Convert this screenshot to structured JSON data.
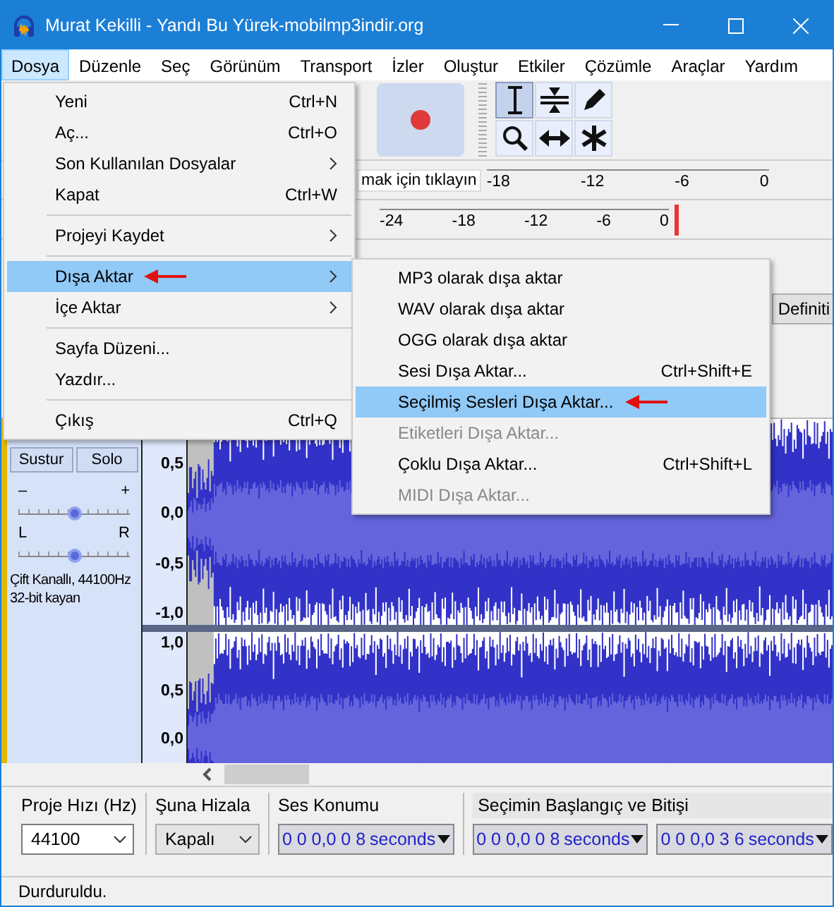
{
  "window": {
    "title": "Murat Kekilli - Yandı Bu Yürek-mobilmp3indir.org"
  },
  "menu_bar": [
    {
      "label": "Dosya",
      "selected": true
    },
    {
      "label": "Düzenle",
      "selected": false
    },
    {
      "label": "Seç",
      "selected": false
    },
    {
      "label": "Görünüm",
      "selected": false
    },
    {
      "label": "Transport",
      "selected": false
    },
    {
      "label": "İzler",
      "selected": false
    },
    {
      "label": "Oluştur",
      "selected": false
    },
    {
      "label": "Etkiler",
      "selected": false
    },
    {
      "label": "Çözümle",
      "selected": false
    },
    {
      "label": "Araçlar",
      "selected": false
    },
    {
      "label": "Yardım",
      "selected": false
    }
  ],
  "file_menu": {
    "items": [
      {
        "kind": "item",
        "label": "Yeni",
        "shortcut": "Ctrl+N",
        "submenu": false,
        "selected": false,
        "pointer_arrow": false
      },
      {
        "kind": "item",
        "label": "Aç...",
        "shortcut": "Ctrl+O",
        "submenu": false,
        "selected": false,
        "pointer_arrow": false
      },
      {
        "kind": "item",
        "label": "Son Kullanılan Dosyalar",
        "submenu": true,
        "selected": false,
        "pointer_arrow": false
      },
      {
        "kind": "item",
        "label": "Kapat",
        "shortcut": "Ctrl+W",
        "submenu": false,
        "selected": false,
        "pointer_arrow": false
      },
      {
        "kind": "separator"
      },
      {
        "kind": "item",
        "label": "Projeyi Kaydet",
        "submenu": true,
        "selected": false,
        "pointer_arrow": false
      },
      {
        "kind": "separator"
      },
      {
        "kind": "item",
        "label": "Dışa Aktar",
        "submenu": true,
        "selected": true,
        "pointer_arrow": true
      },
      {
        "kind": "item",
        "label": "İçe Aktar",
        "submenu": true,
        "selected": false,
        "pointer_arrow": false
      },
      {
        "kind": "separator"
      },
      {
        "kind": "item",
        "label": "Sayfa Düzeni...",
        "submenu": false,
        "selected": false,
        "pointer_arrow": false
      },
      {
        "kind": "item",
        "label": "Yazdır...",
        "submenu": false,
        "selected": false,
        "pointer_arrow": false
      },
      {
        "kind": "separator"
      },
      {
        "kind": "item",
        "label": "Çıkış",
        "shortcut": "Ctrl+Q",
        "submenu": false,
        "selected": false,
        "pointer_arrow": false
      }
    ]
  },
  "export_submenu": {
    "items": [
      {
        "label": "MP3 olarak dışa aktar",
        "selected": false,
        "disabled": false,
        "pointer_arrow": false
      },
      {
        "label": "WAV olarak dışa aktar",
        "selected": false,
        "disabled": false,
        "pointer_arrow": false
      },
      {
        "label": "OGG olarak dışa aktar",
        "selected": false,
        "disabled": false,
        "pointer_arrow": false
      },
      {
        "label": "Sesi Dışa Aktar...",
        "shortcut": "Ctrl+Shift+E",
        "selected": false,
        "disabled": false,
        "pointer_arrow": false
      },
      {
        "label": "Seçilmiş Sesleri Dışa Aktar...",
        "selected": true,
        "disabled": false,
        "pointer_arrow": true
      },
      {
        "label": "Etiketleri Dışa Aktar...",
        "selected": false,
        "disabled": true,
        "pointer_arrow": false
      },
      {
        "label": "Çoklu Dışa Aktar...",
        "shortcut": "Ctrl+Shift+L",
        "selected": false,
        "disabled": false,
        "pointer_arrow": false
      },
      {
        "label": "MIDI Dışa Aktar...",
        "selected": false,
        "disabled": true,
        "pointer_arrow": false
      }
    ]
  },
  "toolbar": {
    "tools": [
      {
        "kind": "ibeam",
        "selected": true
      },
      {
        "kind": "envelope",
        "selected": false
      },
      {
        "kind": "draw",
        "selected": false
      },
      {
        "kind": "zoom",
        "selected": false
      },
      {
        "kind": "timeshift",
        "selected": false
      },
      {
        "kind": "multi",
        "selected": false
      }
    ]
  },
  "meters": [
    {
      "hint": "mak için tıklayın",
      "ticks": [
        "-18",
        "-12",
        "-6",
        "0"
      ]
    },
    {
      "ticks": [
        "-24",
        "-18",
        "-12",
        "-6",
        "0"
      ]
    }
  ],
  "timeline": {
    "button": "Definiti"
  },
  "track": {
    "mute": "Sustur",
    "solo": "Solo",
    "gain": {
      "min_label": "–",
      "max_label": "+",
      "level": 0.5
    },
    "pan": {
      "min_label": "L",
      "max_label": "R",
      "level": 0.5
    },
    "info": [
      "Çift Kanallı, 44100Hz",
      "32-bit kayan"
    ],
    "channels": [
      {
        "ruler": [
          "0,5",
          "0,0",
          "-0,5",
          "-1,0"
        ]
      },
      {
        "ruler": [
          "1,0",
          "0,5",
          "0,0"
        ]
      }
    ]
  },
  "bottom_toolbar": {
    "rate": {
      "label": "Proje Hızı (Hz)",
      "value": "44100"
    },
    "snap": {
      "label": "Şuna Hizala",
      "value": "Kapalı"
    },
    "position": {
      "label": "Ses Konumu",
      "digits": "0 0 0,0 0 8",
      "unit": "seconds"
    },
    "selection": {
      "label": "Seçimin Başlangıç ve Bitişi",
      "start": {
        "digits": "0 0 0,0 0 8",
        "unit": "seconds"
      },
      "end": {
        "digits": "0 0 0,0 3 6",
        "unit": "seconds"
      }
    }
  },
  "status_bar": {
    "text": "Durduruldu."
  }
}
